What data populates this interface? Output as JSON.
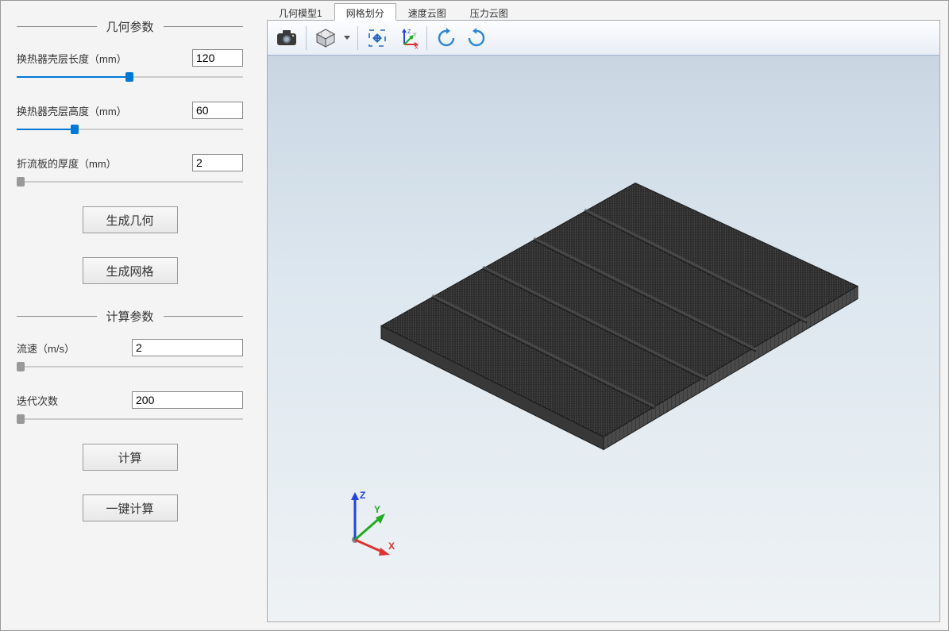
{
  "sidebar": {
    "group1": {
      "title": "几何参数",
      "param1": {
        "label": "换热器壳层长度（mm）",
        "value": "120",
        "slider_pct": 48
      },
      "param2": {
        "label": "换热器壳层高度（mm）",
        "value": "60",
        "slider_pct": 24
      },
      "param3": {
        "label": "折流板的厚度（mm）",
        "value": "2",
        "slider_pct": 0
      },
      "btn_geom": "生成几何",
      "btn_mesh": "生成网格"
    },
    "group2": {
      "title": "计算参数",
      "param_speed": {
        "label": "流速（m/s）",
        "value": "2",
        "slider_pct": 0
      },
      "param_iter": {
        "label": "迭代次数",
        "value": "200",
        "slider_pct": 0
      },
      "btn_calc": "计算",
      "btn_onekey": "一键计算"
    }
  },
  "tabs": {
    "items": [
      "几何模型1",
      "网格划分",
      "速度云图",
      "压力云图"
    ],
    "active_index": 1
  },
  "toolbar": {
    "icons": {
      "camera": "camera-icon",
      "cube": "cube-icon",
      "fit": "fit-view-icon",
      "axes": "axes-icon",
      "undo": "rotate-ccw-icon",
      "redo": "rotate-cw-icon"
    }
  },
  "axis": {
    "x": "X",
    "y": "Y",
    "z": "Z"
  },
  "colors": {
    "accent": "#0078d7",
    "viewport_top": "#c9d6e2",
    "viewport_bottom": "#eef2f5",
    "mesh": "#2b2b2b",
    "axis_x": "#d33",
    "axis_y": "#2a2",
    "axis_z": "#24d"
  }
}
